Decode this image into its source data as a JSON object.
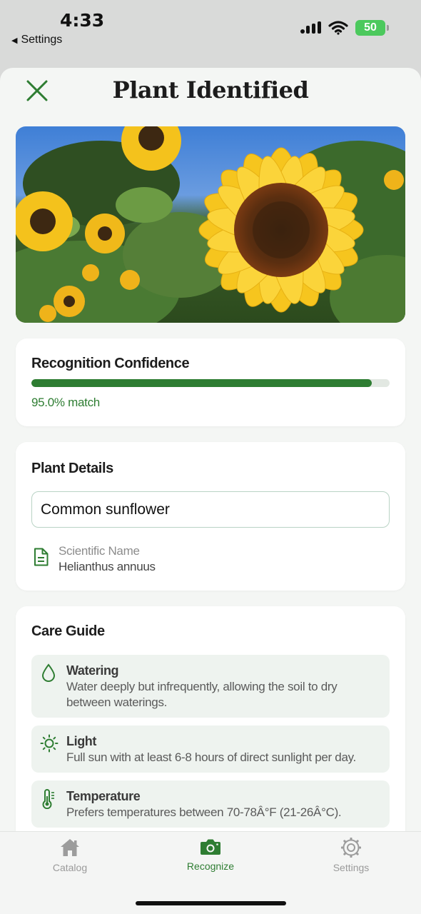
{
  "status_bar": {
    "time": "4:33",
    "back_label": "Settings",
    "battery": "50"
  },
  "header": {
    "title": "Plant Identified"
  },
  "photo": {
    "subject": "sunflower"
  },
  "confidence": {
    "title": "Recognition Confidence",
    "value_percent": 95.0,
    "match_text": "95.0% match",
    "accent_color": "#2e7d32"
  },
  "details": {
    "title": "Plant Details",
    "common_name": "Common sunflower",
    "scientific_label": "Scientific Name",
    "scientific_name": "Helianthus annuus"
  },
  "care": {
    "title": "Care Guide",
    "items": [
      {
        "icon": "water-drop-icon",
        "title": "Watering",
        "desc": "Water deeply but infrequently, allowing the soil to dry between waterings."
      },
      {
        "icon": "sun-icon",
        "title": "Light",
        "desc": "Full sun with at least 6-8 hours of direct sunlight per day."
      },
      {
        "icon": "thermometer-icon",
        "title": "Temperature",
        "desc": "Prefers temperatures between 70-78Â°F (21-26Â°C)."
      }
    ]
  },
  "tabs": [
    {
      "label": "Catalog",
      "icon": "home-icon",
      "active": false
    },
    {
      "label": "Recognize",
      "icon": "camera-icon",
      "active": true
    },
    {
      "label": "Settings",
      "icon": "gear-icon",
      "active": false
    }
  ]
}
